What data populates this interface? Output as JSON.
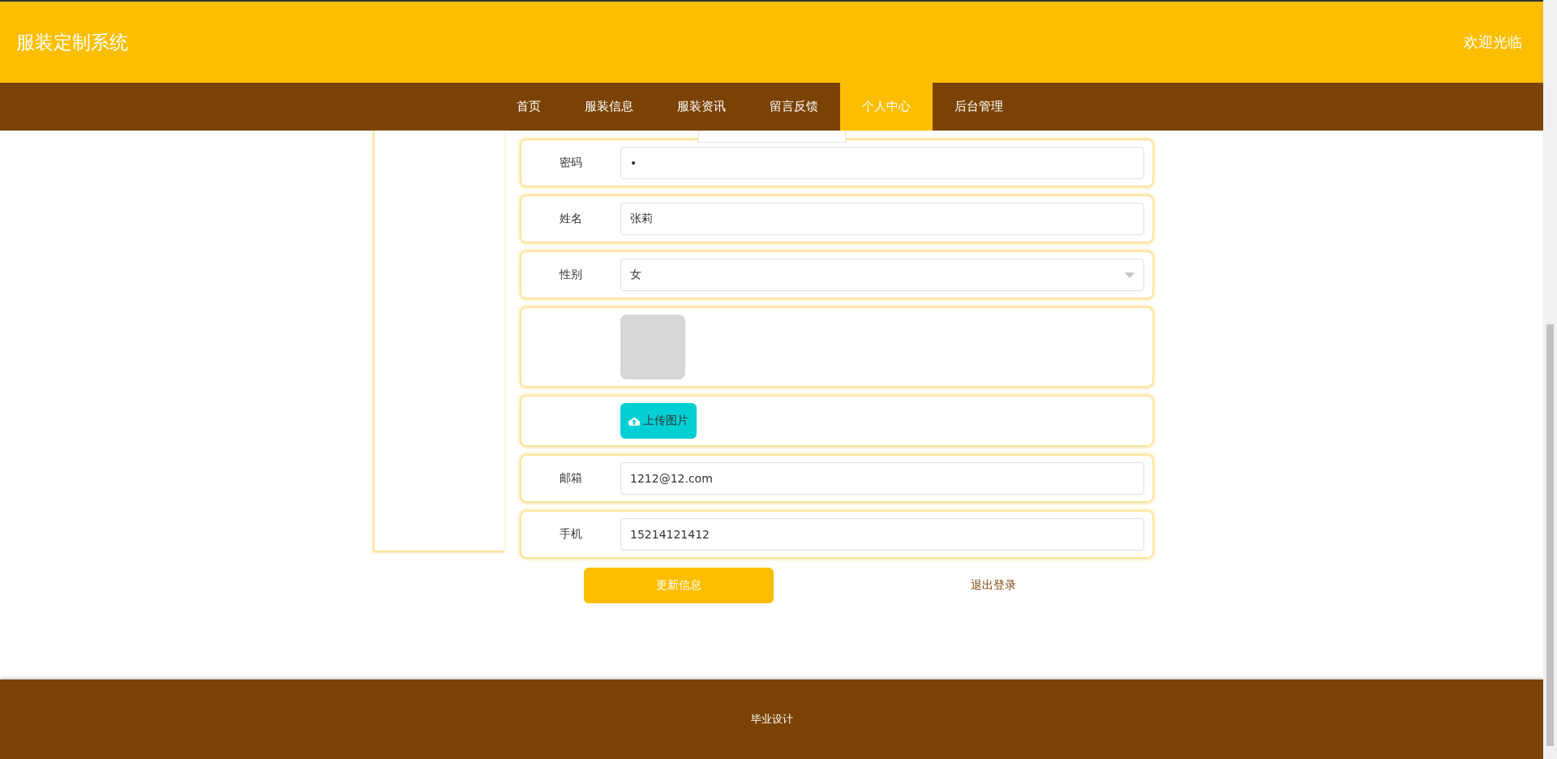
{
  "header": {
    "title": "服装定制系统",
    "greeting": "欢迎光临"
  },
  "nav": [
    {
      "label": "首页",
      "selected": false
    },
    {
      "label": "服装信息",
      "selected": false
    },
    {
      "label": "服装资讯",
      "selected": false
    },
    {
      "label": "留言反馈",
      "selected": false
    },
    {
      "label": "个人中心",
      "selected": true
    },
    {
      "label": "后台管理",
      "selected": false
    }
  ],
  "form": {
    "fields": [
      {
        "kind": "password",
        "label": "密码",
        "value": "•"
      },
      {
        "kind": "text",
        "label": "姓名",
        "value": "张莉"
      },
      {
        "kind": "select",
        "label": "性别",
        "value": "女"
      },
      {
        "kind": "image"
      },
      {
        "kind": "upload",
        "button": "上传图片"
      },
      {
        "kind": "text",
        "label": "邮箱",
        "value": "1212@12.com"
      },
      {
        "kind": "text",
        "label": "手机",
        "value": "15214121412"
      }
    ]
  },
  "actions": {
    "submit": "更新信息",
    "logout": "退出登录"
  },
  "footer": {
    "text": "毕业设计"
  }
}
